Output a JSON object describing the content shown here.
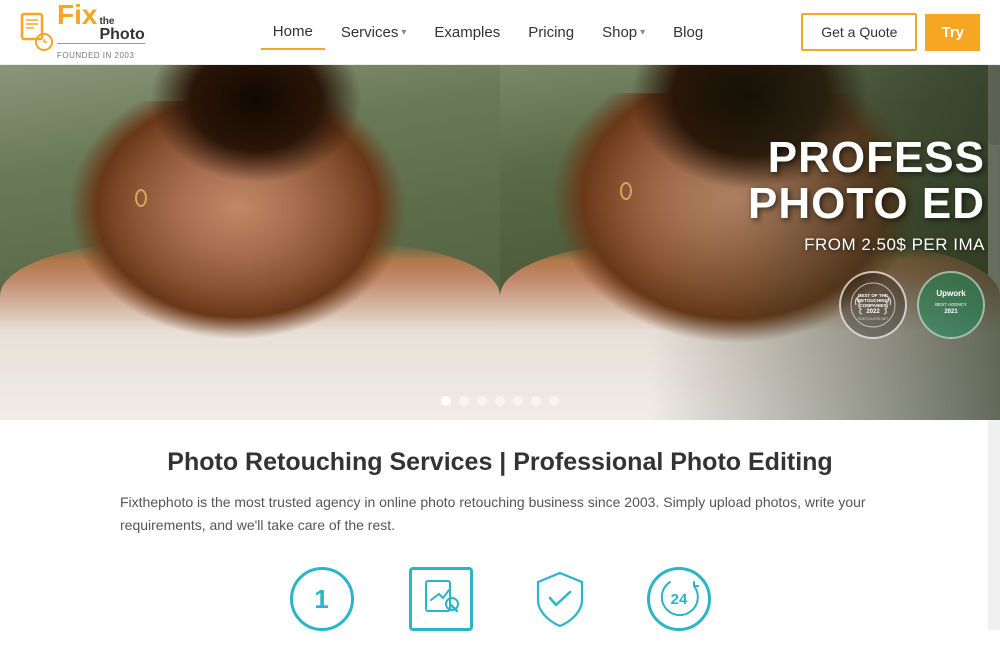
{
  "header": {
    "logo": {
      "fix": "Fix",
      "the_photo": "the\nPhoto",
      "founded": "FOUNDED IN 2003"
    },
    "nav": [
      {
        "label": "Home",
        "active": true,
        "has_dropdown": false
      },
      {
        "label": "Services",
        "active": false,
        "has_dropdown": true
      },
      {
        "label": "Examples",
        "active": false,
        "has_dropdown": false
      },
      {
        "label": "Pricing",
        "active": false,
        "has_dropdown": false
      },
      {
        "label": "Shop",
        "active": false,
        "has_dropdown": true
      },
      {
        "label": "Blog",
        "active": false,
        "has_dropdown": false
      }
    ],
    "btn_quote": "Get a Quote",
    "btn_try": "Try"
  },
  "hero": {
    "headline_line1": "PROFESS",
    "headline_line2": "PHOTO ED",
    "from_price": "FROM 2.50$ PER IMA",
    "badge1": {
      "line1": "BEST OF THE",
      "line2": "RETOUCHING",
      "line3": "COMPANIES",
      "line4": "2022",
      "line5": "©DECOLORS.NET"
    },
    "badge2": {
      "platform": "Upwork",
      "label": "BEST AGENCY",
      "year": "2021"
    },
    "dots": [
      {
        "active": true
      },
      {
        "active": false
      },
      {
        "active": false
      },
      {
        "active": false
      },
      {
        "active": false
      },
      {
        "active": false
      },
      {
        "active": false
      }
    ]
  },
  "content": {
    "title": "Photo Retouching Services | Professional Photo Editing",
    "description": "Fixthephoto is the most trusted agency in online photo retouching business since 2003. Simply upload photos, write your requirements, and we'll take care of the rest.",
    "icons": [
      {
        "type": "number",
        "value": "1"
      },
      {
        "type": "document"
      },
      {
        "type": "shield"
      },
      {
        "type": "clock24",
        "value": "24"
      }
    ]
  }
}
